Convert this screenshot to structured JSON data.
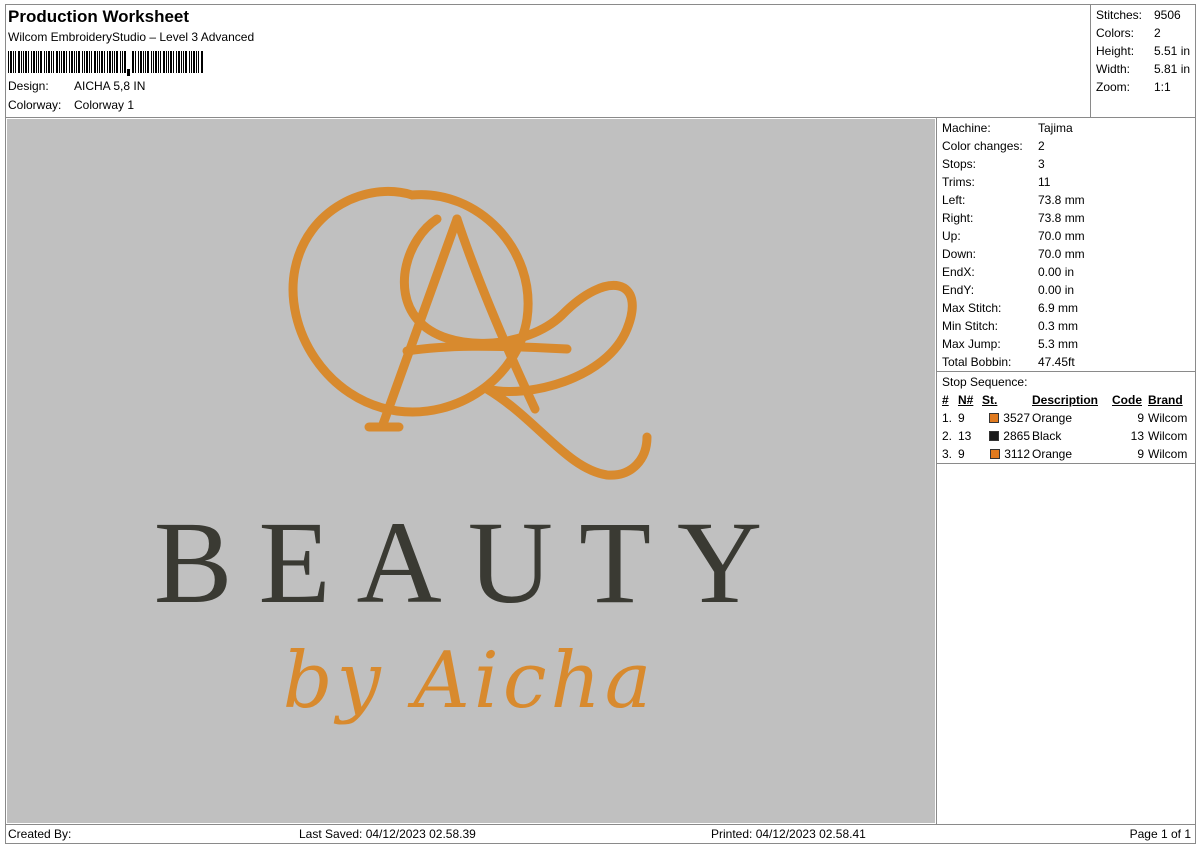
{
  "header": {
    "title": "Production Worksheet",
    "subtitle": "Wilcom EmbroideryStudio – Level 3 Advanced",
    "design_label": "Design:",
    "design_value": "AICHA 5,8 IN",
    "colorway_label": "Colorway:",
    "colorway_value": "Colorway 1"
  },
  "summary": {
    "stitches_label": "Stitches:",
    "stitches": "9506",
    "colors_label": "Colors:",
    "colors": "2",
    "height_label": "Height:",
    "height": "5.51 in",
    "width_label": "Width:",
    "width": "5.81 in",
    "zoom_label": "Zoom:",
    "zoom": "1:1"
  },
  "machine_info": [
    {
      "label": "Machine:",
      "value": "Tajima"
    },
    {
      "label": "Color changes:",
      "value": "2"
    },
    {
      "label": "Stops:",
      "value": "3"
    },
    {
      "label": "Trims:",
      "value": "11"
    },
    {
      "label": "Left:",
      "value": "73.8 mm"
    },
    {
      "label": "Right:",
      "value": "73.8 mm"
    },
    {
      "label": "Up:",
      "value": "70.0 mm"
    },
    {
      "label": "Down:",
      "value": "70.0 mm"
    },
    {
      "label": "EndX:",
      "value": "0.00 in"
    },
    {
      "label": "EndY:",
      "value": "0.00 in"
    },
    {
      "label": "Max Stitch:",
      "value": "6.9 mm"
    },
    {
      "label": "Min Stitch:",
      "value": "0.3 mm"
    },
    {
      "label": "Max Jump:",
      "value": "5.3 mm"
    },
    {
      "label": "Total Bobbin:",
      "value": "47.45ft"
    }
  ],
  "stop_sequence": {
    "title": "Stop Sequence:",
    "headers": [
      "#",
      "N#",
      "St.",
      "Description",
      "Code",
      "Brand"
    ],
    "rows": [
      {
        "num": "1.",
        "n": "9",
        "color": "#e07a1f",
        "st": "3527",
        "desc": "Orange",
        "code": "9",
        "brand": "Wilcom"
      },
      {
        "num": "2.",
        "n": "13",
        "color": "#1a1a1a",
        "st": "2865",
        "desc": "Black",
        "code": "13",
        "brand": "Wilcom"
      },
      {
        "num": "3.",
        "n": "9",
        "color": "#e07a1f",
        "st": "3112",
        "desc": "Orange",
        "code": "9",
        "brand": "Wilcom"
      }
    ]
  },
  "design_artwork": {
    "wordmark": "BEAUTY",
    "script": "by Aicha",
    "thread_orange": "#d88a2e",
    "thread_black": "#3a3a33",
    "background": "#c0c0c0"
  },
  "footer": {
    "created_by": "Created By:",
    "last_saved": "Last Saved: 04/12/2023 02.58.39",
    "printed": "Printed: 04/12/2023 02.58.41",
    "page": "Page 1 of 1"
  }
}
